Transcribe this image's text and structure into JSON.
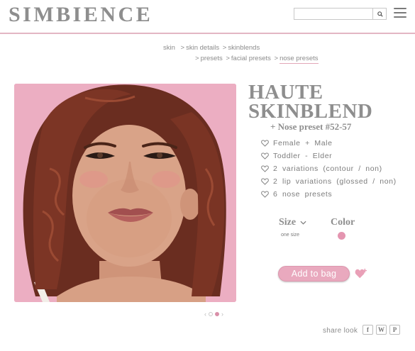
{
  "brand": {
    "logo": "SIMBIENCE"
  },
  "search": {
    "placeholder": "",
    "icon": "search-icon"
  },
  "header": {
    "menu_icon": "hamburger-menu-icon",
    "rule_color": "#e3b6c4"
  },
  "breadcrumb": {
    "line1": [
      {
        "label": "skin",
        "sep": ""
      },
      {
        "label": "skin details",
        "sep": ">"
      },
      {
        "label": "skinblends",
        "sep": ">"
      }
    ],
    "line2": [
      {
        "label": "presets",
        "sep": ">"
      },
      {
        "label": "facial presets",
        "sep": ">"
      },
      {
        "label": "nose presets",
        "sep": ">"
      }
    ]
  },
  "product": {
    "title_line1": "HAUTE",
    "title_line2": "SKINBLEND",
    "subtitle": "+ Nose preset #52-57",
    "features": [
      "Female + Male",
      "Toddler - Elder",
      "2 variations (contour / non)",
      "2 lip variations (glossed / non)",
      "6 nose presets"
    ],
    "size_label": "Size",
    "size_value": "one size",
    "color_label": "Color",
    "swatch_color": "#e495b0",
    "add_to_bag": "Add to bag",
    "wishlist_icon": "heart-plus-icon"
  },
  "gallery": {
    "dot_count": 2,
    "active_dot": 1
  },
  "share": {
    "label": "share look",
    "buttons": [
      {
        "glyph": "f",
        "icon": "facebook-icon"
      },
      {
        "glyph": "W",
        "icon": "twitter-icon"
      },
      {
        "glyph": "P",
        "icon": "pinterest-icon"
      }
    ]
  },
  "colors": {
    "accent": "#e9a9be",
    "heading": "#8e8e8e",
    "backdrop": "#ecaec2"
  }
}
